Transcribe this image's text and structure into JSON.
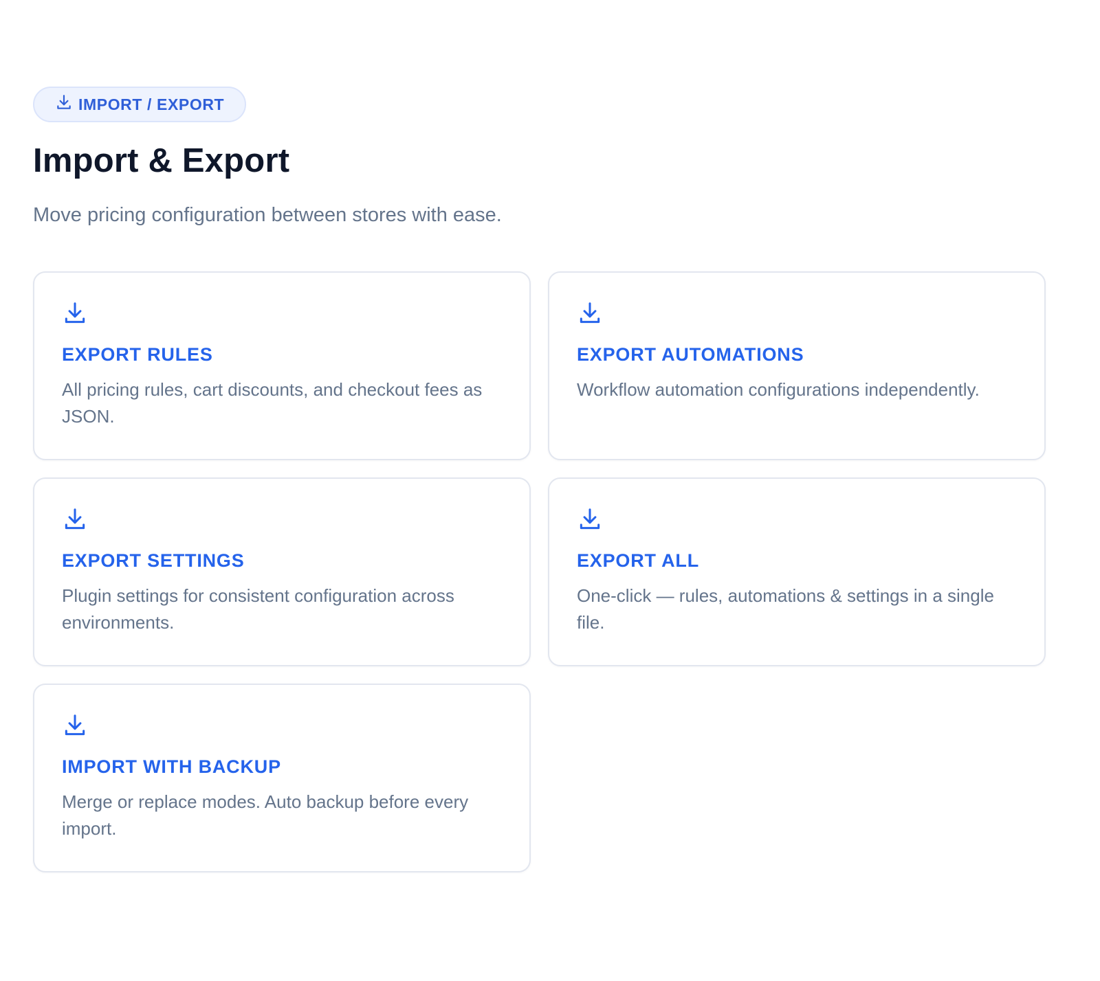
{
  "header": {
    "badge_icon": "download-icon",
    "badge_label": "IMPORT / EXPORT",
    "title": "Import & Export",
    "subtitle": "Move pricing configuration between stores with ease."
  },
  "accent_color": "#2563eb",
  "cards": [
    {
      "icon": "download-icon",
      "title": "EXPORT RULES",
      "description": "All pricing rules, cart discounts, and checkout fees as JSON."
    },
    {
      "icon": "download-icon",
      "title": "EXPORT AUTOMATIONS",
      "description": "Workflow automation configurations independently."
    },
    {
      "icon": "download-icon",
      "title": "EXPORT SETTINGS",
      "description": "Plugin settings for consistent configuration across environments."
    },
    {
      "icon": "download-icon",
      "title": "EXPORT ALL",
      "description": "One-click — rules, automations & settings in a single file."
    },
    {
      "icon": "download-icon",
      "title": "IMPORT WITH BACKUP",
      "description": "Merge or replace modes. Auto backup before every import."
    }
  ]
}
